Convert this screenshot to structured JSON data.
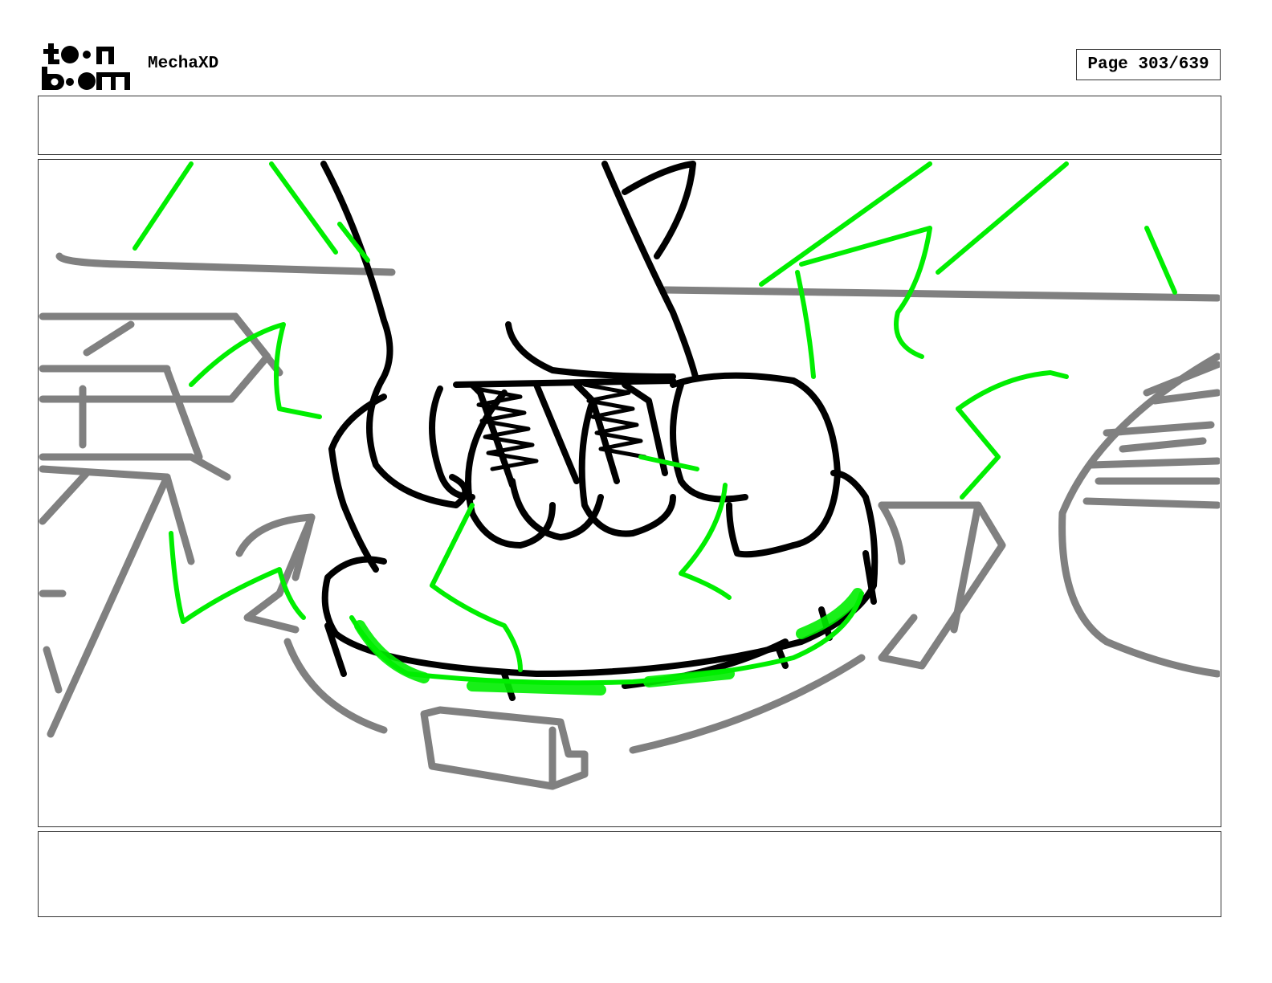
{
  "header": {
    "project_name": "MechaXD",
    "page_label": "Page 303/639"
  },
  "logo": {
    "text": "toon boom",
    "icon": "toon-boom-logo"
  },
  "panel": {
    "dialogue_text": "",
    "notes_text": ""
  },
  "colors": {
    "ink": "#000000",
    "background_lines": "#808080",
    "energy": "#00ee00",
    "frame_border": "#333333"
  }
}
